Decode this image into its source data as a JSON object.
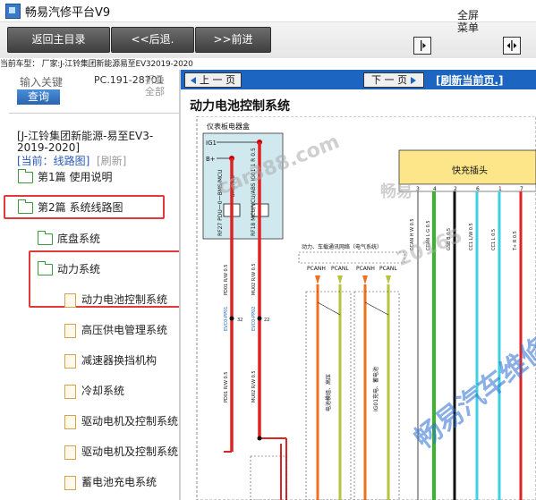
{
  "window": {
    "title": "畅易汽修平台V9"
  },
  "toolbar": {
    "home_label": "返回主目录",
    "back_label": "<<后退.",
    "forward_label": ">>前进",
    "fullscreen_label": "全屏",
    "menu_label": "菜单"
  },
  "vehicle": {
    "line": "当前车型： 厂家:J-江铃集团新能源易至EV32019-2020"
  },
  "search": {
    "keyword_placeholder": "输入关键",
    "button": "查询",
    "code": "PC.191-28701",
    "fold": "折叠全部"
  },
  "tree": {
    "brand": "[J-江铃集团新能源-易至EV3-2019-2020]",
    "current": "[当前：线路图]",
    "refresh": "[刷新]",
    "items": [
      {
        "label": "第1篇 使用说明"
      },
      {
        "label": "第2篇 系统线路图"
      },
      {
        "label": "底盘系统"
      },
      {
        "label": "动力系统"
      },
      {
        "label": "动力电池控制系统"
      },
      {
        "label": "高压供电管理系统"
      },
      {
        "label": "减速器换挡机构"
      },
      {
        "label": "冷却系统"
      },
      {
        "label": "驱动电机及控制系统"
      },
      {
        "label": "驱动电机及控制系统"
      },
      {
        "label": "蓄电池充电系统"
      }
    ]
  },
  "viewer": {
    "prev_label": "上 一 页",
    "next_label": "下 一 页",
    "refresh_label": "[刷新当前页.]",
    "page_title": "动力电池控制系统",
    "diagram": {
      "box_label": "仪表板电器盒",
      "ig1": "IG1",
      "bplus": "B+",
      "bms": "BMS/MCU",
      "pins_left": [
        "RF27 PDU一0一BMS/MCU",
        "RF18 MCU/VCU/ABS IG01 1 R 0.5"
      ],
      "pin_num": [
        "32",
        "22"
      ],
      "wire_labels": [
        "PD01 R/W 0.5",
        "MU02 R/W 0.5",
        "EVC0-PP01",
        "EVC0-PP02",
        "PD01 R/W 0.5",
        "MU02 R/W 0.5"
      ],
      "can_title": "动力、车载通讯网络（电气系统）",
      "can_labels": [
        "PCANH",
        "PCANL",
        "PCANH",
        "PCANL"
      ],
      "can_side": [
        "电池模组、高压",
        "IG01充电、蓄电池"
      ],
      "connector_title": "快充插头",
      "connector_pins": [
        "3",
        "4",
        "2",
        "6",
        "1",
        "7"
      ],
      "connector_wires": [
        "CCAN H W 0.5",
        "CCAN L G 0.5",
        "GSB B 0.5",
        "CC1 L/W 0.5",
        "CC1 L 0.5",
        "T+ R 0.5"
      ]
    },
    "watermarks": [
      "畅易",
      "car388.com",
      "20165",
      "畅易汽车维修"
    ]
  },
  "colors": {
    "nav": "#1c66c2",
    "highlight": "#e23a3a",
    "connector": "#fde68a"
  }
}
